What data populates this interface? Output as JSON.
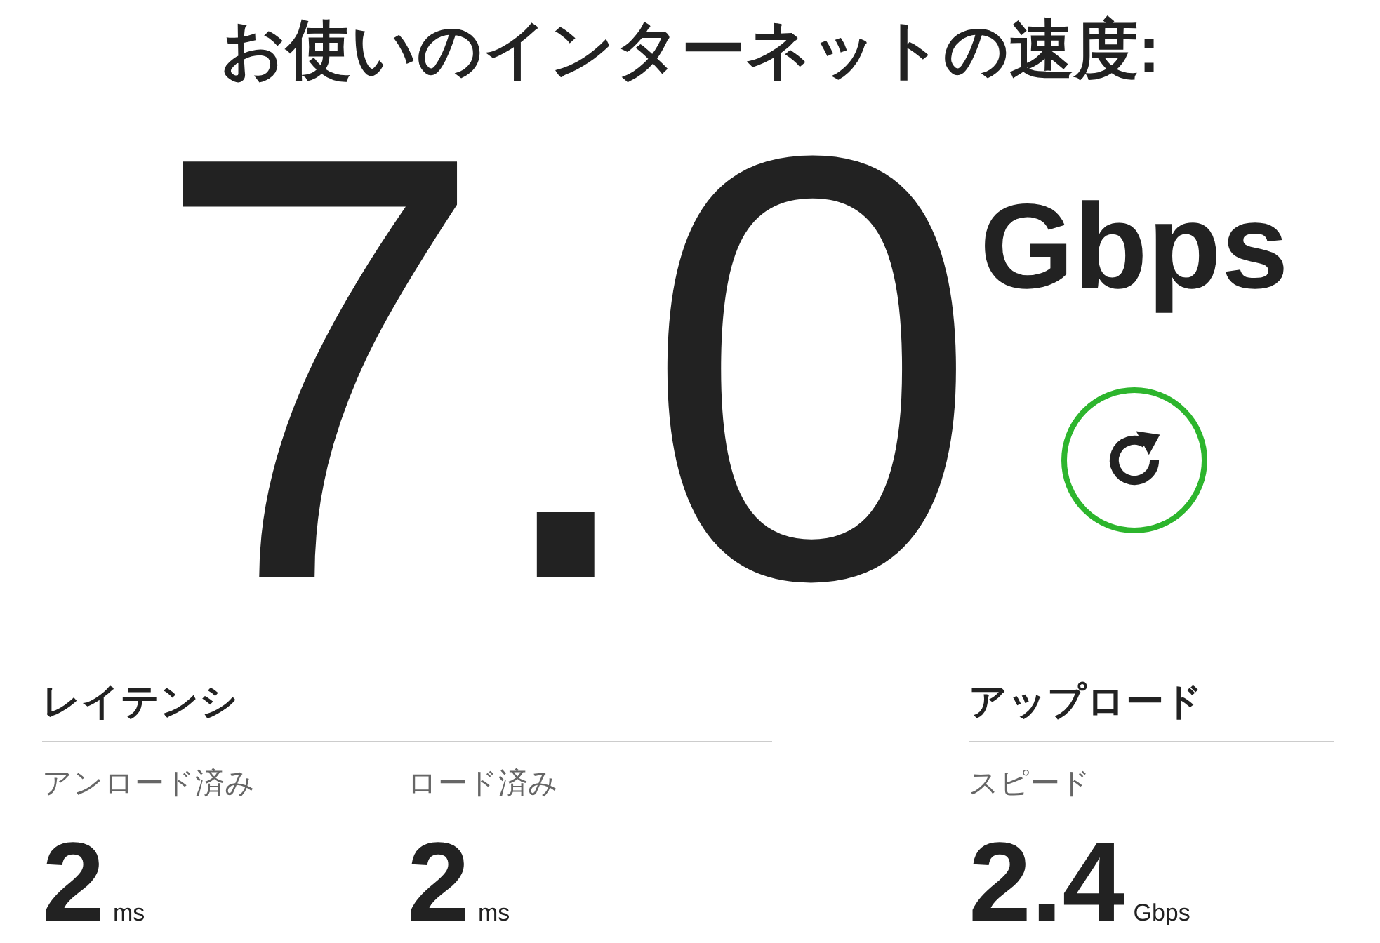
{
  "title": "お使いのインターネットの速度:",
  "speed": {
    "value": "7.0",
    "unit": "Gbps"
  },
  "groups": [
    {
      "heading": "レイテンシ",
      "metrics": [
        {
          "label": "アンロード済み",
          "value": "2",
          "unit": "ms"
        },
        {
          "label": "ロード済み",
          "value": "2",
          "unit": "ms"
        }
      ]
    },
    {
      "heading": "アップロード",
      "metrics": [
        {
          "label": "スピード",
          "value": "2.4",
          "unit": "Gbps"
        }
      ]
    }
  ]
}
